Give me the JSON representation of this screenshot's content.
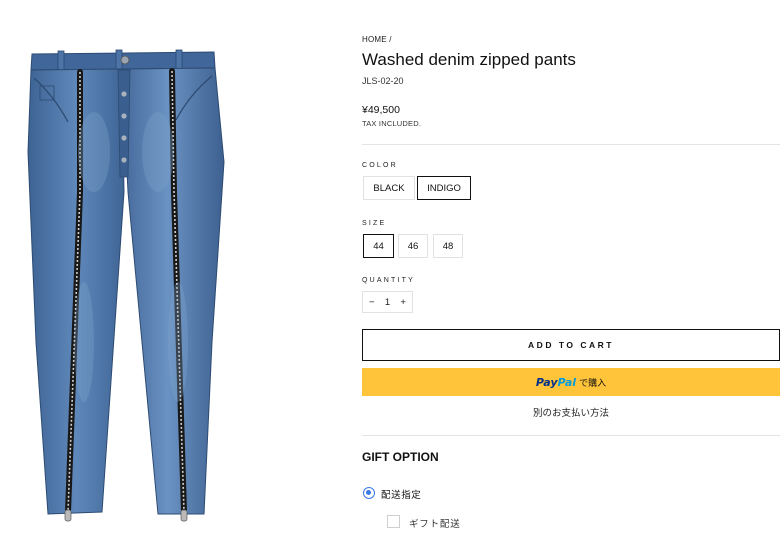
{
  "product": {
    "breadcrumb": "HOME /",
    "title": "Washed denim zipped pants",
    "sku": "JLS-02-20",
    "price": "¥49,500",
    "tax_note": "TAX INCLUDED."
  },
  "options": {
    "color": {
      "label": "COLOR",
      "values": [
        "BLACK",
        "INDIGO"
      ],
      "selected": "INDIGO"
    },
    "size": {
      "label": "SIZE",
      "values": [
        "44",
        "46",
        "48"
      ],
      "selected": "44"
    }
  },
  "quantity": {
    "label": "QUANTITY",
    "minus": "−",
    "value": "1",
    "plus": "+"
  },
  "actions": {
    "add_to_cart": "ADD TO CART",
    "paypal_pay": "Pay",
    "paypal_pal": "Pal",
    "paypal_suffix": "で購入",
    "more_payment": "別のお支払い方法"
  },
  "gift": {
    "title": "GIFT OPTION",
    "radio_label": "配送指定",
    "radio_selected": true,
    "checkbox_label": "ギフト配送",
    "checkbox_checked": false
  },
  "colors": {
    "paypal_yellow": "#ffc439",
    "paypal_dark_blue": "#003087",
    "paypal_light_blue": "#009cde",
    "radio_blue": "#3b78e7",
    "denim": "#466c9c"
  },
  "icons": {
    "product_image": "washed-denim-jeans-with-two-front-zippers"
  }
}
